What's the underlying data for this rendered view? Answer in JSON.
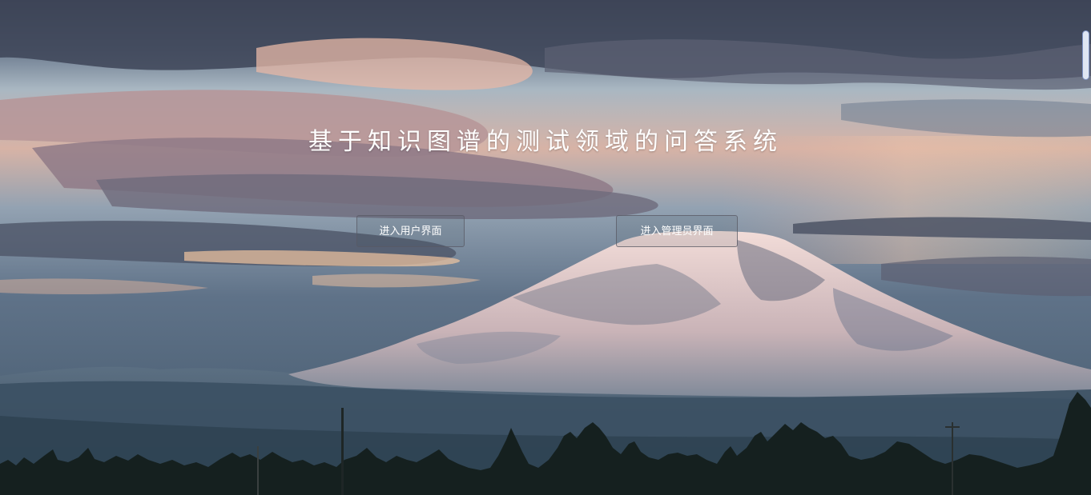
{
  "page": {
    "title": "基于知识图谱的测试领域的问答系统"
  },
  "buttons": {
    "user_label": "进入用户界面",
    "admin_label": "进入管理员界面"
  },
  "background": {
    "scene": "mountain-landscape-image"
  }
}
